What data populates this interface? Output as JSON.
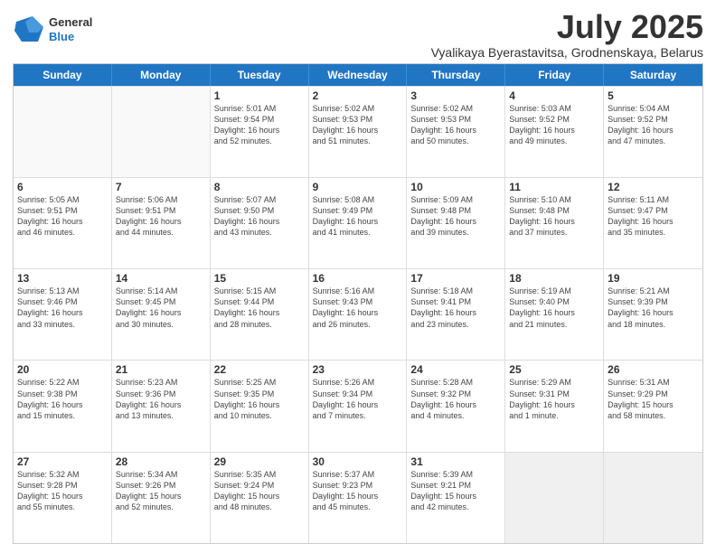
{
  "header": {
    "logo_line1": "General",
    "logo_line2": "Blue",
    "title": "July 2025",
    "subtitle": "Vyalikaya Byerastavitsa, Grodnenskaya, Belarus"
  },
  "calendar": {
    "days_of_week": [
      "Sunday",
      "Monday",
      "Tuesday",
      "Wednesday",
      "Thursday",
      "Friday",
      "Saturday"
    ],
    "weeks": [
      [
        {
          "day": "",
          "empty": true
        },
        {
          "day": "",
          "empty": true
        },
        {
          "day": "1",
          "line1": "Sunrise: 5:01 AM",
          "line2": "Sunset: 9:54 PM",
          "line3": "Daylight: 16 hours",
          "line4": "and 52 minutes."
        },
        {
          "day": "2",
          "line1": "Sunrise: 5:02 AM",
          "line2": "Sunset: 9:53 PM",
          "line3": "Daylight: 16 hours",
          "line4": "and 51 minutes."
        },
        {
          "day": "3",
          "line1": "Sunrise: 5:02 AM",
          "line2": "Sunset: 9:53 PM",
          "line3": "Daylight: 16 hours",
          "line4": "and 50 minutes."
        },
        {
          "day": "4",
          "line1": "Sunrise: 5:03 AM",
          "line2": "Sunset: 9:52 PM",
          "line3": "Daylight: 16 hours",
          "line4": "and 49 minutes."
        },
        {
          "day": "5",
          "line1": "Sunrise: 5:04 AM",
          "line2": "Sunset: 9:52 PM",
          "line3": "Daylight: 16 hours",
          "line4": "and 47 minutes."
        }
      ],
      [
        {
          "day": "6",
          "line1": "Sunrise: 5:05 AM",
          "line2": "Sunset: 9:51 PM",
          "line3": "Daylight: 16 hours",
          "line4": "and 46 minutes."
        },
        {
          "day": "7",
          "line1": "Sunrise: 5:06 AM",
          "line2": "Sunset: 9:51 PM",
          "line3": "Daylight: 16 hours",
          "line4": "and 44 minutes."
        },
        {
          "day": "8",
          "line1": "Sunrise: 5:07 AM",
          "line2": "Sunset: 9:50 PM",
          "line3": "Daylight: 16 hours",
          "line4": "and 43 minutes."
        },
        {
          "day": "9",
          "line1": "Sunrise: 5:08 AM",
          "line2": "Sunset: 9:49 PM",
          "line3": "Daylight: 16 hours",
          "line4": "and 41 minutes."
        },
        {
          "day": "10",
          "line1": "Sunrise: 5:09 AM",
          "line2": "Sunset: 9:48 PM",
          "line3": "Daylight: 16 hours",
          "line4": "and 39 minutes."
        },
        {
          "day": "11",
          "line1": "Sunrise: 5:10 AM",
          "line2": "Sunset: 9:48 PM",
          "line3": "Daylight: 16 hours",
          "line4": "and 37 minutes."
        },
        {
          "day": "12",
          "line1": "Sunrise: 5:11 AM",
          "line2": "Sunset: 9:47 PM",
          "line3": "Daylight: 16 hours",
          "line4": "and 35 minutes."
        }
      ],
      [
        {
          "day": "13",
          "line1": "Sunrise: 5:13 AM",
          "line2": "Sunset: 9:46 PM",
          "line3": "Daylight: 16 hours",
          "line4": "and 33 minutes."
        },
        {
          "day": "14",
          "line1": "Sunrise: 5:14 AM",
          "line2": "Sunset: 9:45 PM",
          "line3": "Daylight: 16 hours",
          "line4": "and 30 minutes."
        },
        {
          "day": "15",
          "line1": "Sunrise: 5:15 AM",
          "line2": "Sunset: 9:44 PM",
          "line3": "Daylight: 16 hours",
          "line4": "and 28 minutes."
        },
        {
          "day": "16",
          "line1": "Sunrise: 5:16 AM",
          "line2": "Sunset: 9:43 PM",
          "line3": "Daylight: 16 hours",
          "line4": "and 26 minutes."
        },
        {
          "day": "17",
          "line1": "Sunrise: 5:18 AM",
          "line2": "Sunset: 9:41 PM",
          "line3": "Daylight: 16 hours",
          "line4": "and 23 minutes."
        },
        {
          "day": "18",
          "line1": "Sunrise: 5:19 AM",
          "line2": "Sunset: 9:40 PM",
          "line3": "Daylight: 16 hours",
          "line4": "and 21 minutes."
        },
        {
          "day": "19",
          "line1": "Sunrise: 5:21 AM",
          "line2": "Sunset: 9:39 PM",
          "line3": "Daylight: 16 hours",
          "line4": "and 18 minutes."
        }
      ],
      [
        {
          "day": "20",
          "line1": "Sunrise: 5:22 AM",
          "line2": "Sunset: 9:38 PM",
          "line3": "Daylight: 16 hours",
          "line4": "and 15 minutes."
        },
        {
          "day": "21",
          "line1": "Sunrise: 5:23 AM",
          "line2": "Sunset: 9:36 PM",
          "line3": "Daylight: 16 hours",
          "line4": "and 13 minutes."
        },
        {
          "day": "22",
          "line1": "Sunrise: 5:25 AM",
          "line2": "Sunset: 9:35 PM",
          "line3": "Daylight: 16 hours",
          "line4": "and 10 minutes."
        },
        {
          "day": "23",
          "line1": "Sunrise: 5:26 AM",
          "line2": "Sunset: 9:34 PM",
          "line3": "Daylight: 16 hours",
          "line4": "and 7 minutes."
        },
        {
          "day": "24",
          "line1": "Sunrise: 5:28 AM",
          "line2": "Sunset: 9:32 PM",
          "line3": "Daylight: 16 hours",
          "line4": "and 4 minutes."
        },
        {
          "day": "25",
          "line1": "Sunrise: 5:29 AM",
          "line2": "Sunset: 9:31 PM",
          "line3": "Daylight: 16 hours",
          "line4": "and 1 minute."
        },
        {
          "day": "26",
          "line1": "Sunrise: 5:31 AM",
          "line2": "Sunset: 9:29 PM",
          "line3": "Daylight: 15 hours",
          "line4": "and 58 minutes."
        }
      ],
      [
        {
          "day": "27",
          "line1": "Sunrise: 5:32 AM",
          "line2": "Sunset: 9:28 PM",
          "line3": "Daylight: 15 hours",
          "line4": "and 55 minutes."
        },
        {
          "day": "28",
          "line1": "Sunrise: 5:34 AM",
          "line2": "Sunset: 9:26 PM",
          "line3": "Daylight: 15 hours",
          "line4": "and 52 minutes."
        },
        {
          "day": "29",
          "line1": "Sunrise: 5:35 AM",
          "line2": "Sunset: 9:24 PM",
          "line3": "Daylight: 15 hours",
          "line4": "and 48 minutes."
        },
        {
          "day": "30",
          "line1": "Sunrise: 5:37 AM",
          "line2": "Sunset: 9:23 PM",
          "line3": "Daylight: 15 hours",
          "line4": "and 45 minutes."
        },
        {
          "day": "31",
          "line1": "Sunrise: 5:39 AM",
          "line2": "Sunset: 9:21 PM",
          "line3": "Daylight: 15 hours",
          "line4": "and 42 minutes."
        },
        {
          "day": "",
          "empty": true
        },
        {
          "day": "",
          "empty": true
        }
      ]
    ]
  }
}
